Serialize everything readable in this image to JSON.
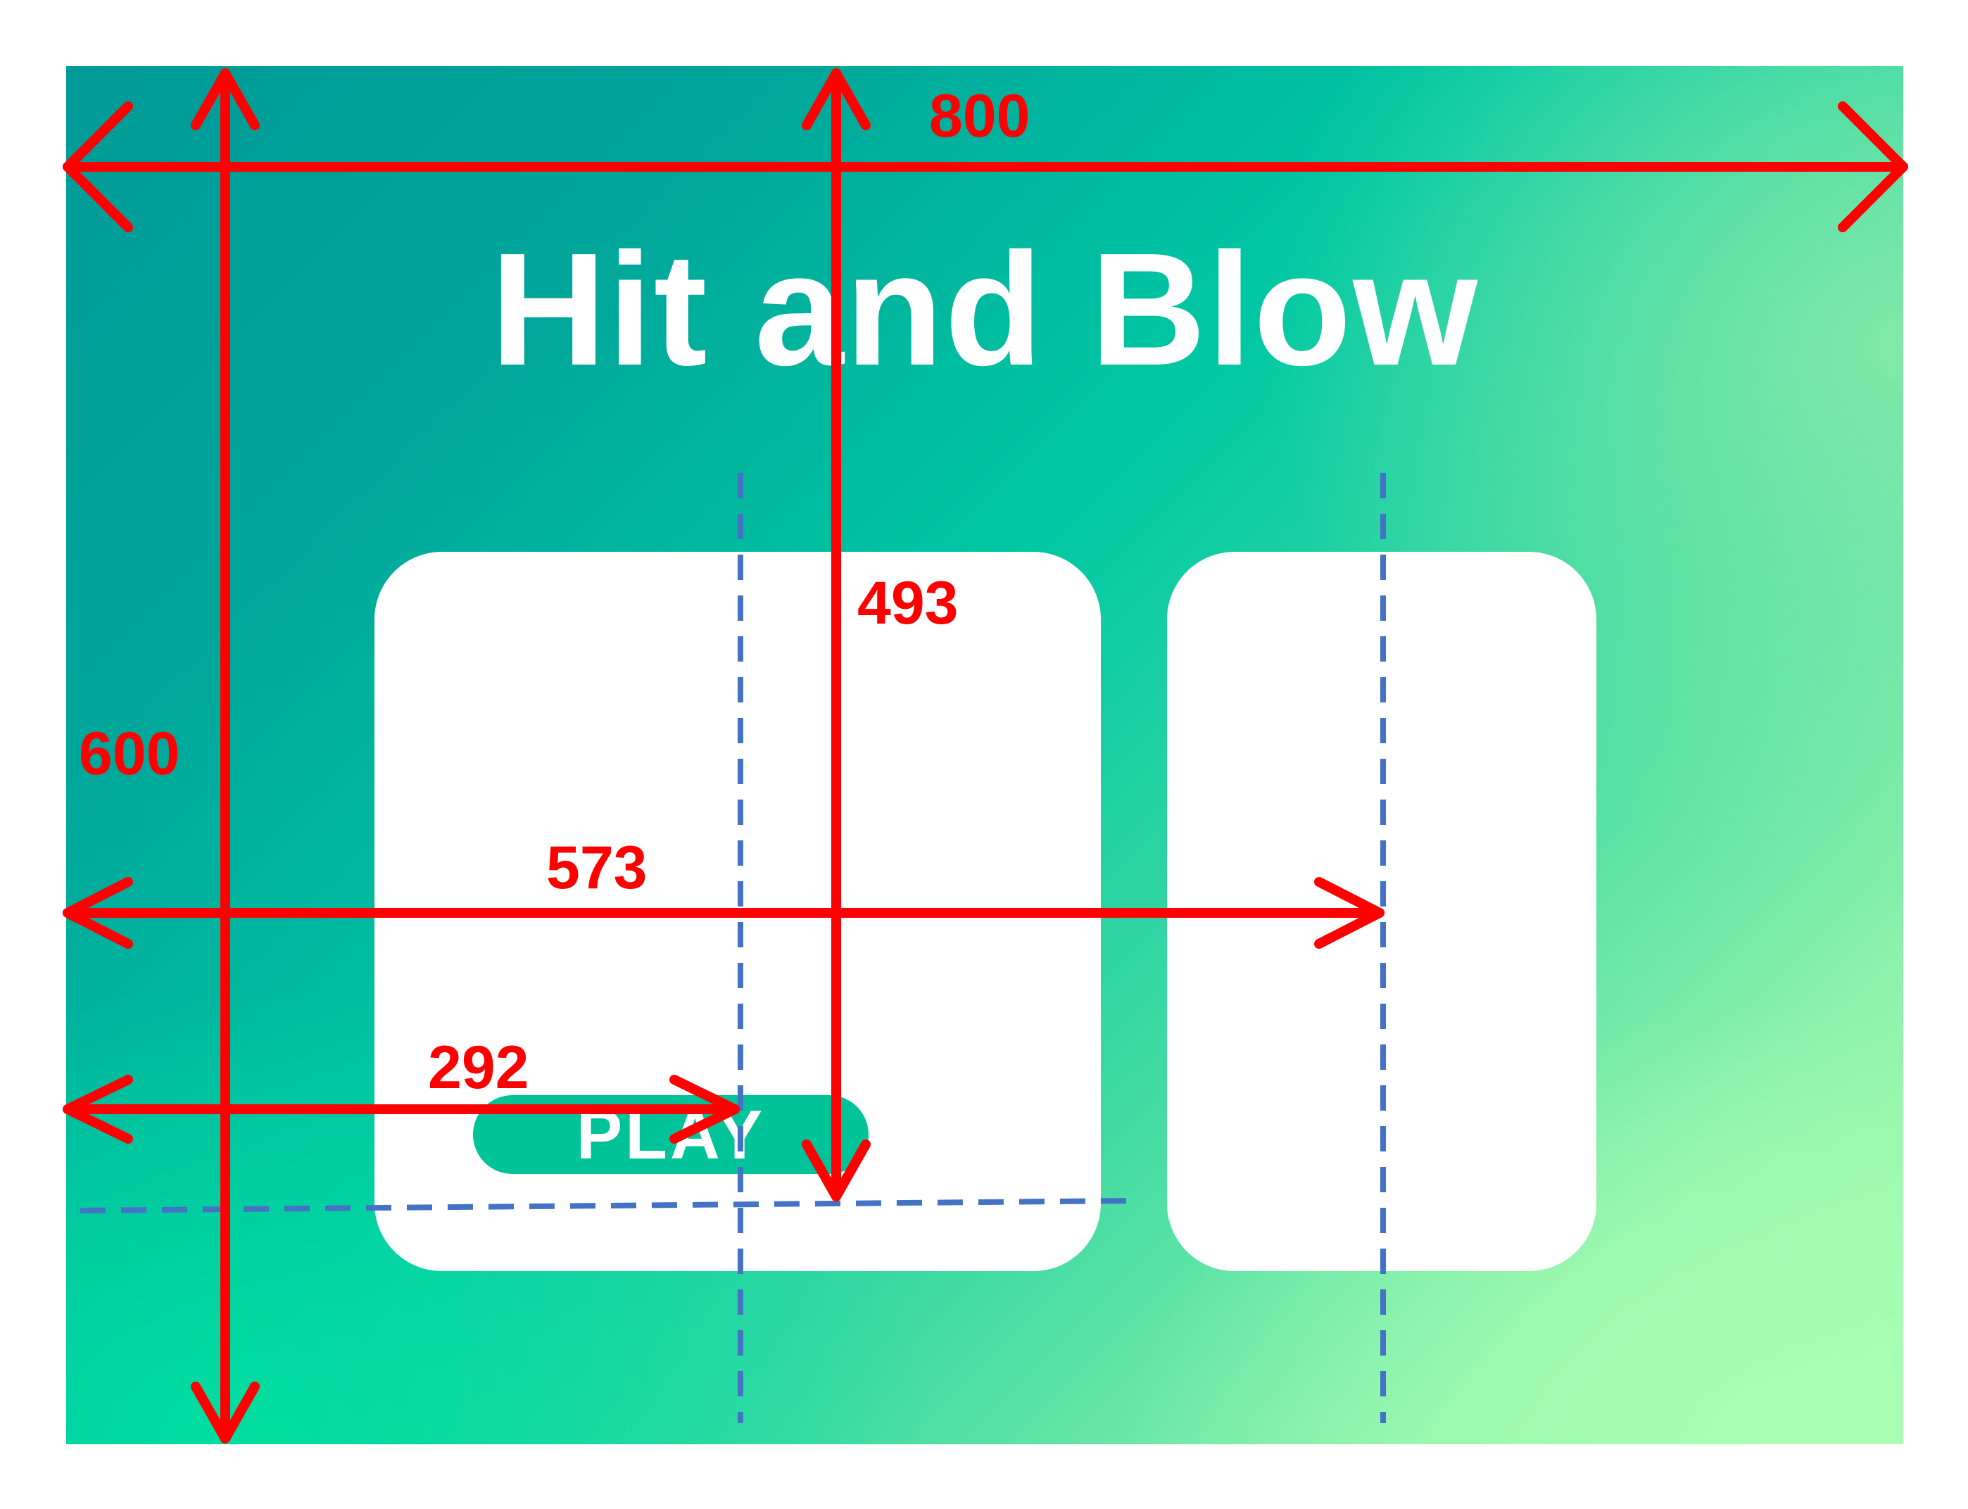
{
  "game": {
    "title": "Hit and Blow",
    "play_button_label": "PLAY"
  },
  "annotations": {
    "canvas_width_label": "800",
    "canvas_height_label": "600",
    "play_center_y_label": "493",
    "side_panel_center_x_label": "573",
    "main_panel_center_x_label": "292"
  },
  "colors": {
    "dimension_arrow": "#ff0000",
    "guide_line": "#4472c4",
    "panel": "#ffffff",
    "play_button": "#00c39a",
    "title": "#ffffff"
  }
}
